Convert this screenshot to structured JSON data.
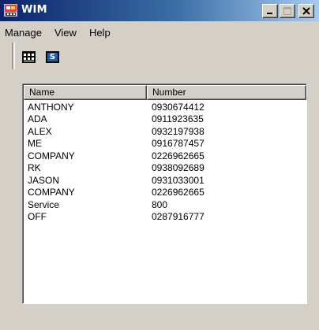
{
  "window": {
    "title": "WIM"
  },
  "menu": {
    "items": [
      "Manage",
      "View",
      "Help"
    ]
  },
  "toolbar": {
    "buttons": [
      {
        "icon": "grid-icon"
      },
      {
        "icon": "s-icon",
        "label": "S"
      }
    ]
  },
  "list": {
    "columns": [
      "Name",
      "Number"
    ],
    "rows": [
      {
        "name": "ANTHONY",
        "number": "0930674412"
      },
      {
        "name": "ADA",
        "number": "0911923635"
      },
      {
        "name": "ALEX",
        "number": "0932197938"
      },
      {
        "name": "ME",
        "number": "0916787457"
      },
      {
        "name": "COMPANY",
        "number": "0226962665"
      },
      {
        "name": "RK",
        "number": "0938092689"
      },
      {
        "name": "JASON",
        "number": "0931033001"
      },
      {
        "name": "COMPANY",
        "number": "0226962665"
      },
      {
        "name": "Service",
        "number": "800"
      },
      {
        "name": "OFF",
        "number": "0287916777"
      }
    ]
  },
  "colors": {
    "titlebar_start": "#0a246a",
    "titlebar_end": "#a6caf0",
    "face": "#d4d0c8",
    "list_bg": "#ffffff"
  }
}
